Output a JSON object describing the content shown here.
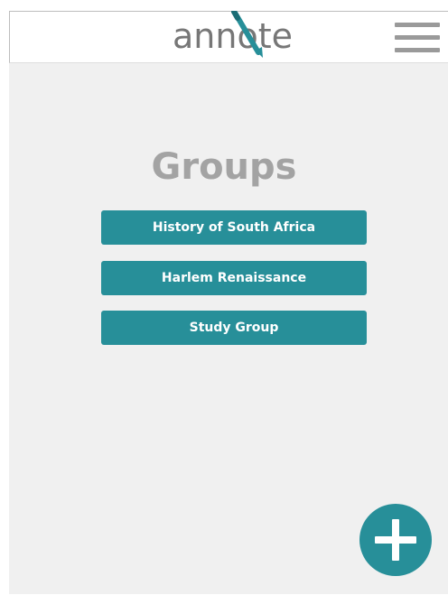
{
  "header": {
    "logo_part1": "ann",
    "logo_o": "o",
    "logo_part2": "te",
    "menu_icon": "hamburger-menu-icon"
  },
  "main": {
    "title": "Groups",
    "groups": [
      {
        "label": "History of South Africa"
      },
      {
        "label": "Harlem Renaissance"
      },
      {
        "label": "Study Group"
      }
    ]
  },
  "fab": {
    "icon": "plus-icon"
  },
  "colors": {
    "accent": "#278f99",
    "background": "#f0f0f0",
    "title": "#a3a3a3",
    "logo_text": "#777777",
    "menu_icon": "#9a9a9a"
  }
}
